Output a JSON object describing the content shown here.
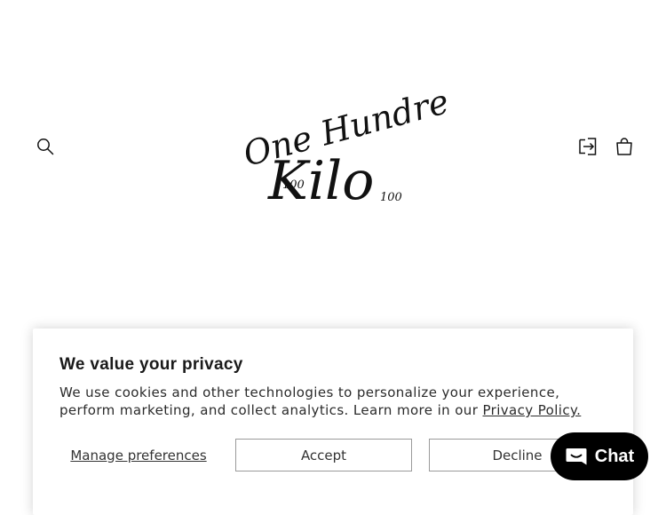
{
  "header": {
    "logo": {
      "line1": "One Hundred",
      "line2": "Kilo",
      "num_left": "100",
      "num_right": "100"
    },
    "icons": {
      "search": "search-icon",
      "account": "account-icon",
      "cart": "cart-icon"
    }
  },
  "cookie_banner": {
    "title": "We value your privacy",
    "text": "We use cookies and other technologies to personalize your experience, perform marketing, and collect analytics. Learn more in our",
    "link": "Privacy Policy.",
    "manage_label": "Manage preferences",
    "accept_label": "Accept",
    "decline_label": "Decline"
  },
  "chat": {
    "label": "Chat",
    "icon": "chat-bubble-icon",
    "color": "#000000"
  }
}
